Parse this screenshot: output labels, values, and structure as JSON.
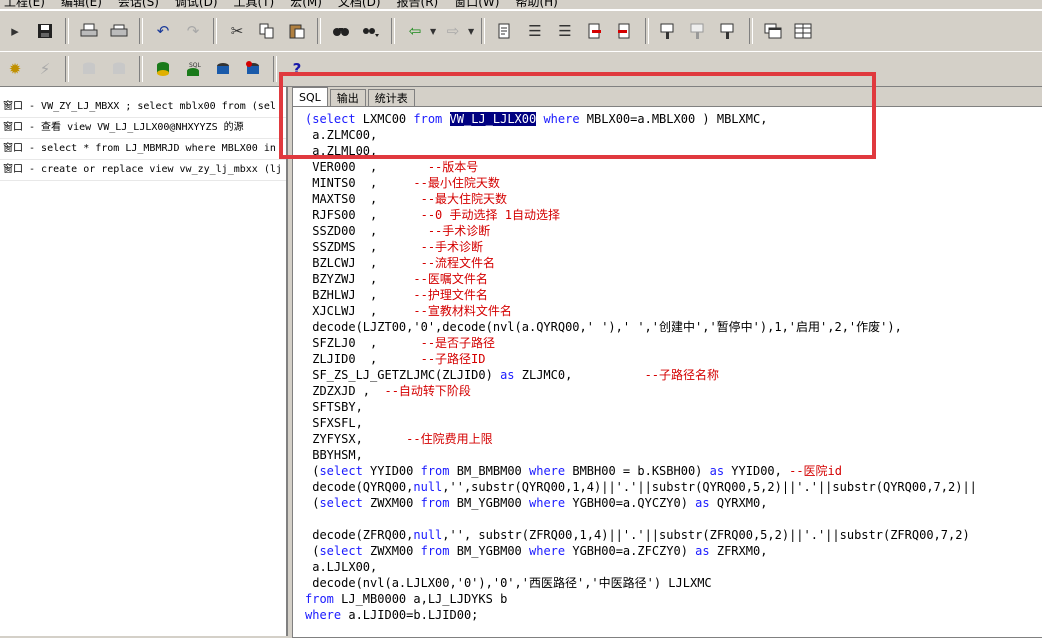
{
  "menubar": {
    "items": [
      "工程(E)",
      "编辑(E)",
      "会话(S)",
      "调试(D)",
      "工具(T)",
      "宏(M)",
      "文档(D)",
      "报告(R)",
      "窗口(W)",
      "帮助(H)"
    ]
  },
  "toolbar1": {
    "icons": [
      "open-icon",
      "save-icon",
      "print-icon",
      "print-preview-icon",
      "undo-icon",
      "redo-icon",
      "cut-icon",
      "copy-icon",
      "paste-icon",
      "find-icon",
      "find-next-icon",
      "import-icon",
      "export-icon",
      "describe-icon",
      "indent-icon",
      "outdent-icon",
      "comment-icon",
      "uncomment-icon",
      "query-builder-icon",
      "explain-plan-icon",
      "dbms-output-icon",
      "window-icon",
      "grid-icon"
    ]
  },
  "toolbar2": {
    "help_label": "?"
  },
  "window_list": [
    "窗口 - VW_ZY_LJ_MBXX ; select mblx00 from (sel",
    "窗口 - 查看 view VW_LJ_LJLX00@NHXYYZS 的源",
    "窗口 - select * from LJ_MBMRJD where MBLX00 in",
    "窗口 - create or replace view vw_zy_lj_mbxx (lj"
  ],
  "tabs": [
    {
      "label": "SQL",
      "active": true
    },
    {
      "label": "输出",
      "active": false
    },
    {
      "label": "统计表",
      "active": false
    }
  ],
  "code_lines": [
    [
      [
        "k",
        "(select"
      ],
      [
        "t",
        " LXMC00 "
      ],
      [
        "k",
        "from"
      ],
      [
        "t",
        " "
      ],
      [
        "s",
        "VW_LJ_LJLX00"
      ],
      [
        "t",
        " "
      ],
      [
        "k",
        "where"
      ],
      [
        "t",
        " MBLX00=a.MBLX00 ) MBLXMC,"
      ]
    ],
    [
      [
        "t",
        " a.ZLMC00,"
      ]
    ],
    [
      [
        "t",
        " a.ZLML00,"
      ]
    ],
    [
      [
        "t",
        " VER000  ,       "
      ],
      [
        "c",
        "--版本号"
      ]
    ],
    [
      [
        "t",
        " MINTS0  ,     "
      ],
      [
        "c",
        "--最小住院天数"
      ]
    ],
    [
      [
        "t",
        " MAXTS0  ,      "
      ],
      [
        "c",
        "--最大住院天数"
      ]
    ],
    [
      [
        "t",
        " RJFS00  ,      "
      ],
      [
        "c",
        "--0 手动选择 1自动选择"
      ]
    ],
    [
      [
        "t",
        " SSZD00  ,       "
      ],
      [
        "c",
        "--手术诊断"
      ]
    ],
    [
      [
        "t",
        " SSZDMS  ,      "
      ],
      [
        "c",
        "--手术诊断"
      ]
    ],
    [
      [
        "t",
        " BZLCWJ  ,      "
      ],
      [
        "c",
        "--流程文件名"
      ]
    ],
    [
      [
        "t",
        " BZYZWJ  ,     "
      ],
      [
        "c",
        "--医嘱文件名"
      ]
    ],
    [
      [
        "t",
        " BZHLWJ  ,     "
      ],
      [
        "c",
        "--护理文件名"
      ]
    ],
    [
      [
        "t",
        " XJCLWJ  ,     "
      ],
      [
        "c",
        "--宣教材料文件名"
      ]
    ],
    [
      [
        "t",
        " decode(LJZT00,'0',decode(nvl(a.QYRQ00,' '),' ','创建中','暂停中'),1,'启用',2,'作废'),"
      ]
    ],
    [
      [
        "t",
        " SFZLJ0  ,      "
      ],
      [
        "c",
        "--是否子路径"
      ]
    ],
    [
      [
        "t",
        " ZLJID0  ,      "
      ],
      [
        "c",
        "--子路径ID"
      ]
    ],
    [
      [
        "t",
        " SF_ZS_LJ_GETZLJMC(ZLJID0) "
      ],
      [
        "k",
        "as"
      ],
      [
        "t",
        " ZLJMC0,          "
      ],
      [
        "c",
        "--子路径名称"
      ]
    ],
    [
      [
        "t",
        " ZDZXJD ,  "
      ],
      [
        "c",
        "--自动转下阶段"
      ]
    ],
    [
      [
        "t",
        " SFTSBY,"
      ]
    ],
    [
      [
        "t",
        " SFXSFL,"
      ]
    ],
    [
      [
        "t",
        " ZYFYSX,      "
      ],
      [
        "c",
        "--住院费用上限"
      ]
    ],
    [
      [
        "t",
        " BBYHSM,"
      ]
    ],
    [
      [
        "t",
        " ("
      ],
      [
        "k",
        "select"
      ],
      [
        "t",
        " YYID00 "
      ],
      [
        "k",
        "from"
      ],
      [
        "t",
        " BM_BMBM00 "
      ],
      [
        "k",
        "where"
      ],
      [
        "t",
        " BMBH00 = b.KSBH00) "
      ],
      [
        "k",
        "as"
      ],
      [
        "t",
        " YYID00, "
      ],
      [
        "c",
        "--医院id"
      ]
    ],
    [
      [
        "t",
        " decode(QYRQ00,"
      ],
      [
        "k",
        "null"
      ],
      [
        "t",
        ",'',substr(QYRQ00,1,4)||'.'||substr(QYRQ00,5,2)||'.'||substr(QYRQ00,7,2)||"
      ]
    ],
    [
      [
        "t",
        " ("
      ],
      [
        "k",
        "select"
      ],
      [
        "t",
        " ZWXM00 "
      ],
      [
        "k",
        "from"
      ],
      [
        "t",
        " BM_YGBM00 "
      ],
      [
        "k",
        "where"
      ],
      [
        "t",
        " YGBH00=a.QYCZY0) "
      ],
      [
        "k",
        "as"
      ],
      [
        "t",
        " QYRXM0,"
      ]
    ],
    [
      [
        "t",
        ""
      ]
    ],
    [
      [
        "t",
        " decode(ZFRQ00,"
      ],
      [
        "k",
        "null"
      ],
      [
        "t",
        ",'', substr(ZFRQ00,1,4)||'.'||substr(ZFRQ00,5,2)||'.'||substr(ZFRQ00,7,2)"
      ]
    ],
    [
      [
        "t",
        " ("
      ],
      [
        "k",
        "select"
      ],
      [
        "t",
        " ZWXM00 "
      ],
      [
        "k",
        "from"
      ],
      [
        "t",
        " BM_YGBM00 "
      ],
      [
        "k",
        "where"
      ],
      [
        "t",
        " YGBH00=a.ZFCZY0) "
      ],
      [
        "k",
        "as"
      ],
      [
        "t",
        " ZFRXM0,"
      ]
    ],
    [
      [
        "t",
        " a.LJLX00,"
      ]
    ],
    [
      [
        "t",
        " decode(nvl(a.LJLX00,'0'),'0','西医路径','中医路径') LJLXMC"
      ]
    ],
    [
      [
        "k",
        "from"
      ],
      [
        "t",
        " LJ_MB0000 a,LJ_LJDYKS b"
      ]
    ],
    [
      [
        "k",
        "where"
      ],
      [
        "t",
        " a.LJID00=b.LJID00;"
      ]
    ]
  ],
  "colors": {
    "keyword": "#1a1aff",
    "comment": "#d40000",
    "selection": "#000080",
    "highlight_box": "#e0393e"
  }
}
